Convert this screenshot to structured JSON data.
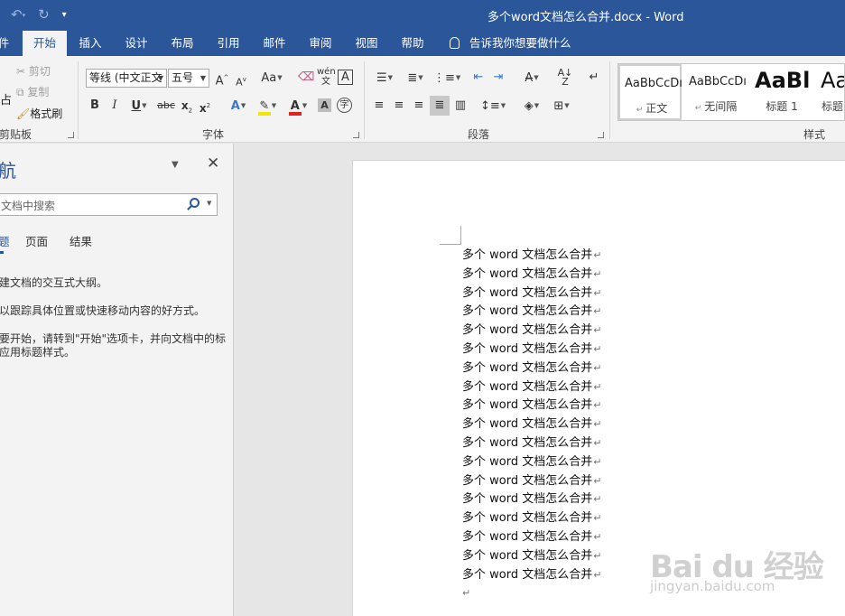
{
  "window": {
    "title": "多个word文档怎么合并.docx  -  Word"
  },
  "quick_access": {
    "undo_icon": "undo-arrow",
    "redo_icon": "redo-arrow",
    "customize_icon": "dropdown-caret"
  },
  "tabs": [
    {
      "label": "件",
      "active": false
    },
    {
      "label": "开始",
      "active": true
    },
    {
      "label": "插入",
      "active": false
    },
    {
      "label": "设计",
      "active": false
    },
    {
      "label": "布局",
      "active": false
    },
    {
      "label": "引用",
      "active": false
    },
    {
      "label": "邮件",
      "active": false
    },
    {
      "label": "审阅",
      "active": false
    },
    {
      "label": "视图",
      "active": false
    },
    {
      "label": "帮助",
      "active": false
    }
  ],
  "tell_me": "告诉我你想要做什么",
  "ribbon": {
    "clipboard": {
      "paste": "占",
      "cut": "剪切",
      "copy": "复制",
      "format_painter": "格式刷",
      "group_label": "剪贴板"
    },
    "font": {
      "font_name": "等线 (中文正文",
      "font_size": "五号",
      "grow": "A",
      "shrink": "A",
      "change_case": "Aa",
      "bold": "B",
      "italic": "I",
      "underline": "U",
      "strikethrough": "abc",
      "subscript": "x",
      "superscript": "x",
      "text_effects": "A",
      "font_color": "A",
      "char_shading": "A",
      "enclose": "字",
      "phonetic": "wén",
      "char_border": "A",
      "group_label": "字体"
    },
    "paragraph": {
      "group_label": "段落"
    },
    "styles": {
      "items": [
        {
          "sample": "AaBbCcDı",
          "name": "正文"
        },
        {
          "sample": "AaBbCcDı",
          "name": "无间隔"
        },
        {
          "sample": "AaBl",
          "name": "标题 1"
        },
        {
          "sample": "AaI",
          "name": "标题"
        }
      ],
      "group_label": "样式"
    }
  },
  "nav_pane": {
    "title": "航",
    "search_placeholder": "文档中搜索",
    "tabs": [
      "题",
      "页面",
      "结果"
    ],
    "help_lines": [
      "建文档的交互式大纲。",
      "以跟踪具体位置或快速移动内容的好方式。",
      "要开始，请转到\"开始\"选项卡，并向文档中的标",
      "应用标题样式。"
    ]
  },
  "document": {
    "lines": [
      "多个 word 文档怎么合并",
      "多个 word 文档怎么合并",
      "多个 word 文档怎么合并",
      "多个 word 文档怎么合并",
      "多个 word 文档怎么合并",
      "多个 word 文档怎么合并",
      "多个 word 文档怎么合并",
      "多个 word 文档怎么合并",
      "多个 word 文档怎么合并",
      "多个 word 文档怎么合并",
      "多个 word 文档怎么合并",
      "多个 word 文档怎么合并",
      "多个 word 文档怎么合并",
      "多个 word 文档怎么合并",
      "多个 word 文档怎么合并",
      "多个 word 文档怎么合并",
      "多个 word 文档怎么合并",
      "多个 word 文档怎么合并"
    ],
    "paragraph_mark": "↵"
  },
  "watermark": {
    "logo": "Bai du 经验",
    "url": "jingyan.baidu.com"
  },
  "colors": {
    "brand": "#2b579a",
    "ribbon_bg": "#f3f3f3",
    "canvas_bg": "#e6e6e6"
  }
}
